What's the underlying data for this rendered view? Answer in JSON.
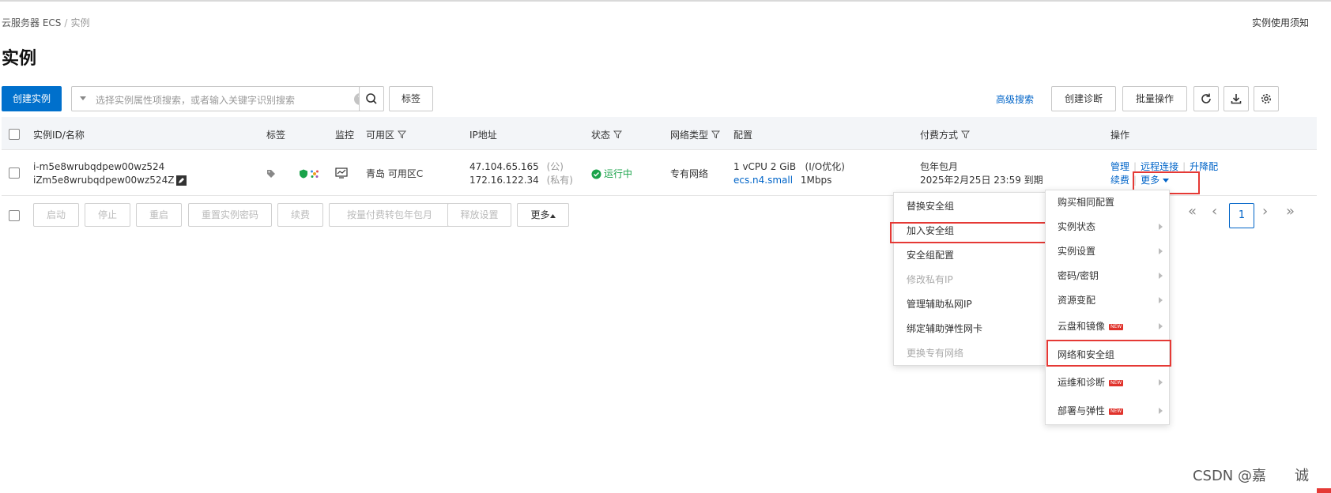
{
  "breadcrumb": {
    "root": "云服务器 ECS",
    "separator": "/",
    "current": "实例"
  },
  "notice_link": "实例使用须知",
  "page_title": "实例",
  "toolbar": {
    "create_instance": "创建实例",
    "search_placeholder": "选择实例属性项搜索，或者输入关键字识别搜索",
    "help_glyph": "?",
    "tag_button": "标签",
    "advanced_search": "高级搜索",
    "create_diagnosis": "创建诊断",
    "batch_ops": "批量操作"
  },
  "table": {
    "headers": {
      "id_name": "实例ID/名称",
      "tags": "标签",
      "monitor": "监控",
      "zone": "可用区",
      "ip": "IP地址",
      "status": "状态",
      "network": "网络类型",
      "config": "配置",
      "billing": "付费方式",
      "actions": "操作"
    },
    "row": {
      "instance_id": "i-m5e8wrubqdpew00wz524",
      "instance_name": "iZm5e8wrubqdpew00wz524Z",
      "zone": "青岛 可用区C",
      "public_ip": "47.104.65.165",
      "public_tag": "(公)",
      "private_ip": "172.16.122.34",
      "private_tag": "(私有)",
      "status": "运行中",
      "network": "专有网络",
      "config_line1": "1 vCPU 2 GiB   (I/O优化)",
      "config_spec": "ecs.n4.small",
      "config_bw": "1Mbps",
      "billing_type": "包年包月",
      "billing_expiry": "2025年2月25日 23:59 到期",
      "actions": {
        "manage": "管理",
        "remote": "远程连接",
        "upgrade": "升降配",
        "renew": "续费",
        "more": "更多"
      }
    }
  },
  "bulk": {
    "start": "启动",
    "stop": "停止",
    "restart": "重启",
    "reset_password": "重置实例密码",
    "renew": "续费",
    "convert": "按量付费转包年包月",
    "release": "释放设置",
    "more": "更多"
  },
  "pagination": {
    "first": "«",
    "prev": "‹",
    "current": "1",
    "next": "›",
    "last": "»"
  },
  "more_menu": [
    {
      "label": "购买相同配置",
      "submenu": false,
      "is_new": false
    },
    {
      "label": "实例状态",
      "submenu": true,
      "is_new": false
    },
    {
      "label": "实例设置",
      "submenu": true,
      "is_new": false
    },
    {
      "label": "密码/密钥",
      "submenu": true,
      "is_new": false
    },
    {
      "label": "资源变配",
      "submenu": true,
      "is_new": false
    },
    {
      "label": "云盘和镜像",
      "submenu": true,
      "is_new": true
    },
    {
      "label": "网络和安全组",
      "submenu": false,
      "is_new": false
    },
    {
      "label": "运维和诊断",
      "submenu": true,
      "is_new": true
    },
    {
      "label": "部署与弹性",
      "submenu": true,
      "is_new": true
    }
  ],
  "new_badge": "NEW",
  "sub_menu": [
    {
      "label": "替换安全组",
      "disabled": false
    },
    {
      "label": "加入安全组",
      "disabled": false
    },
    {
      "label": "安全组配置",
      "disabled": false
    },
    {
      "label": "修改私有IP",
      "disabled": true
    },
    {
      "label": "管理辅助私网IP",
      "disabled": false
    },
    {
      "label": "绑定辅助弹性网卡",
      "disabled": false
    },
    {
      "label": "更换专有网络",
      "disabled": true
    }
  ],
  "watermark": "CSDN @嘉　　诚",
  "colors": {
    "primary": "#0070cc",
    "link": "#0064c8",
    "running": "#1aa34a",
    "highlight": "#e53935"
  }
}
